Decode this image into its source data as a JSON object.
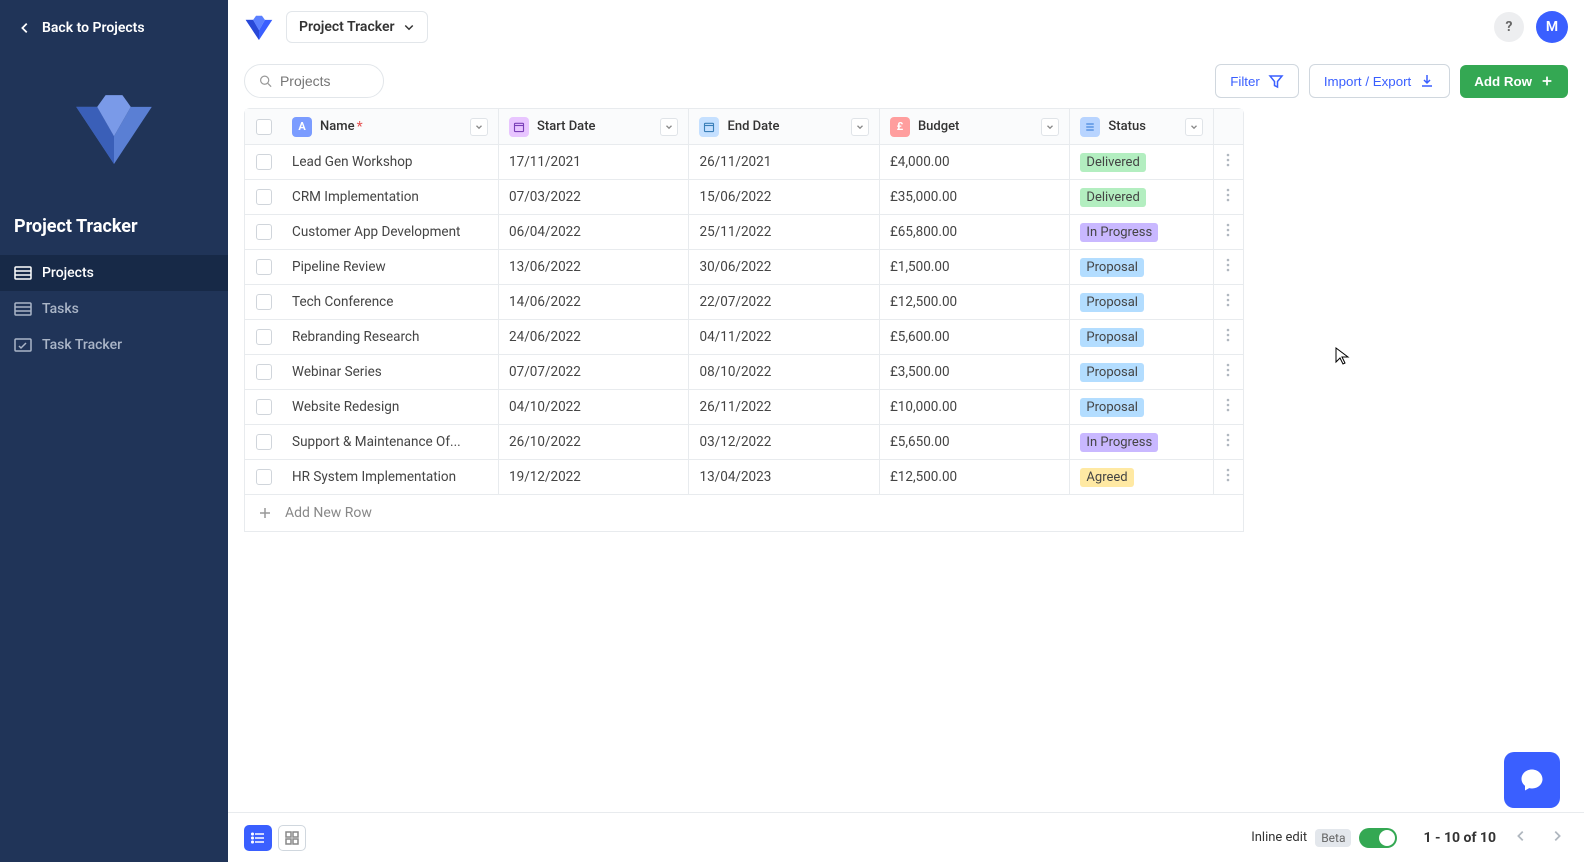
{
  "sidebar": {
    "back_label": "Back to Projects",
    "app_title": "Project Tracker",
    "nav": [
      {
        "label": "Projects",
        "icon": "list"
      },
      {
        "label": "Tasks",
        "icon": "list"
      },
      {
        "label": "Task Tracker",
        "icon": "tracker"
      }
    ]
  },
  "header": {
    "switcher_label": "Project Tracker",
    "avatar_initial": "M",
    "help_label": "?"
  },
  "toolbar": {
    "search_placeholder": "Projects",
    "filter_label": "Filter",
    "import_export_label": "Import / Export",
    "add_row_label": "Add Row"
  },
  "table": {
    "columns": [
      {
        "label": "Name",
        "required": true,
        "badge": "A",
        "badge_class": "type-a"
      },
      {
        "label": "Start Date",
        "required": false,
        "badge": "cal",
        "badge_class": "type-cal1"
      },
      {
        "label": "End Date",
        "required": false,
        "badge": "cal",
        "badge_class": "type-cal2"
      },
      {
        "label": "Budget",
        "required": false,
        "badge": "£",
        "badge_class": "type-pound"
      },
      {
        "label": "Status",
        "required": false,
        "badge": "list",
        "badge_class": "type-list"
      }
    ],
    "rows": [
      {
        "name": "Lead Gen Workshop",
        "start": "17/11/2021",
        "end": "26/11/2021",
        "budget": "£4,000.00",
        "status": "Delivered",
        "status_class": "s-delivered"
      },
      {
        "name": "CRM Implementation",
        "start": "07/03/2022",
        "end": "15/06/2022",
        "budget": "£35,000.00",
        "status": "Delivered",
        "status_class": "s-delivered"
      },
      {
        "name": "Customer App Development",
        "start": "06/04/2022",
        "end": "25/11/2022",
        "budget": "£65,800.00",
        "status": "In Progress",
        "status_class": "s-in-progress"
      },
      {
        "name": "Pipeline Review",
        "start": "13/06/2022",
        "end": "30/06/2022",
        "budget": "£1,500.00",
        "status": "Proposal",
        "status_class": "s-proposal"
      },
      {
        "name": "Tech Conference",
        "start": "14/06/2022",
        "end": "22/07/2022",
        "budget": "£12,500.00",
        "status": "Proposal",
        "status_class": "s-proposal"
      },
      {
        "name": "Rebranding Research",
        "start": "24/06/2022",
        "end": "04/11/2022",
        "budget": "£5,600.00",
        "status": "Proposal",
        "status_class": "s-proposal"
      },
      {
        "name": "Webinar Series",
        "start": "07/07/2022",
        "end": "08/10/2022",
        "budget": "£3,500.00",
        "status": "Proposal",
        "status_class": "s-proposal"
      },
      {
        "name": "Website Redesign",
        "start": "04/10/2022",
        "end": "26/11/2022",
        "budget": "£10,000.00",
        "status": "Proposal",
        "status_class": "s-proposal"
      },
      {
        "name": "Support & Maintenance Of...",
        "start": "26/10/2022",
        "end": "03/12/2022",
        "budget": "£5,650.00",
        "status": "In Progress",
        "status_class": "s-in-progress"
      },
      {
        "name": "HR System Implementation",
        "start": "19/12/2022",
        "end": "13/04/2023",
        "budget": "£12,500.00",
        "status": "Agreed",
        "status_class": "s-agreed"
      }
    ],
    "add_row_label": "Add New Row"
  },
  "footer": {
    "inline_edit_label": "Inline edit",
    "beta_label": "Beta",
    "pagination": "1 - 10 of 10"
  }
}
